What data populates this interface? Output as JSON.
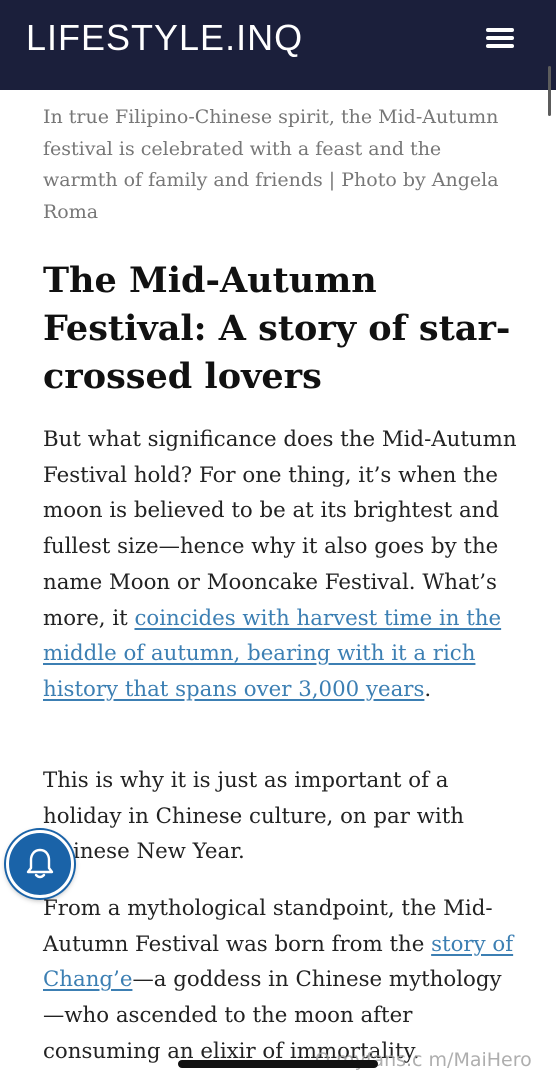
{
  "header": {
    "logo": "LIFESTYLE.INQ",
    "menu_icon": "hamburger-menu-icon",
    "background": "#1b1f3b"
  },
  "article": {
    "caption": "In true Filipino-Chinese spirit, the Mid-Autumn festival is celebrated with a feast and the warmth of family and friends | Photo by Angela Roma",
    "heading": "The Mid-Autumn Festival: A story of star-crossed lovers",
    "p1_text": "But what significance does the Mid-Autumn Festival hold? For one thing, it’s when the moon is believed to be at its brightest and fullest size—hence why it also goes by the name Moon or Mooncake Festival. What’s more, it ",
    "p1_link": "coincides with harvest time in the middle of autumn, bearing with it a rich history that spans over 3,000 years",
    "p1_end": ".",
    "p2_text": "This is why it is just as important of a holiday in Chinese culture, on par with Chinese New Year.",
    "p3_text": "From a mythological standpoint, the Mid-Autumn Festival was born from the ",
    "p3_link": "story of Chang’e",
    "p3_end": "—a goddess in Chinese mythology—who ascended to the moon after consuming an elixir of immortality."
  },
  "notification_button": {
    "icon": "bell-icon",
    "color": "#1a63a8"
  },
  "link_color": "#3c7fb3",
  "watermark": "O myfans.c m/MaiHero"
}
